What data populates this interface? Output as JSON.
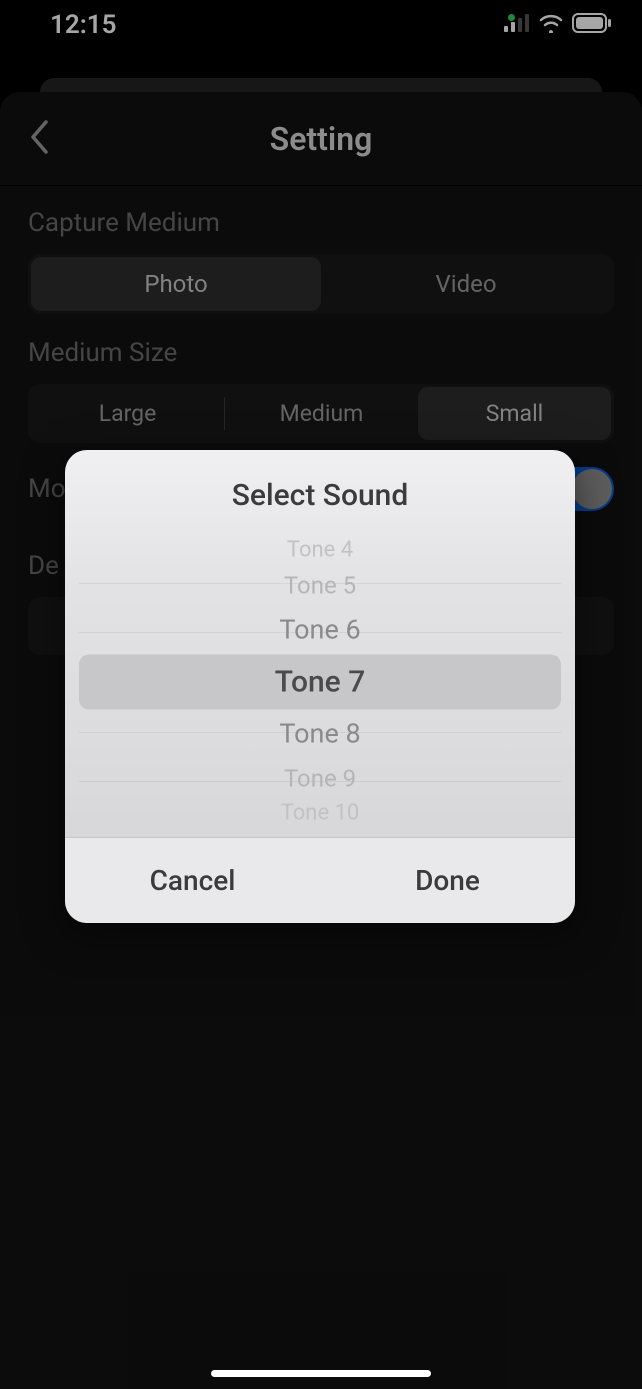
{
  "status": {
    "time": "12:15"
  },
  "nav": {
    "title": "Setting"
  },
  "sections": {
    "captureMedium": {
      "label": "Capture Medium",
      "options": [
        "Photo",
        "Video"
      ],
      "selectedIndex": 0
    },
    "mediumSize": {
      "label": "Medium Size",
      "options": [
        "Large",
        "Medium",
        "Small"
      ],
      "selectedIndex": 2
    },
    "toggleRow": {
      "label_prefix": "Mo"
    },
    "defaultRow": {
      "label_prefix": "De"
    }
  },
  "dialog": {
    "title": "Select Sound",
    "picker": {
      "items": [
        "Tone 4",
        "Tone 5",
        "Tone 6",
        "Tone 7",
        "Tone 8",
        "Tone 9",
        "Tone 10"
      ],
      "selectedIndex": 3
    },
    "buttons": {
      "cancel": "Cancel",
      "done": "Done"
    }
  }
}
